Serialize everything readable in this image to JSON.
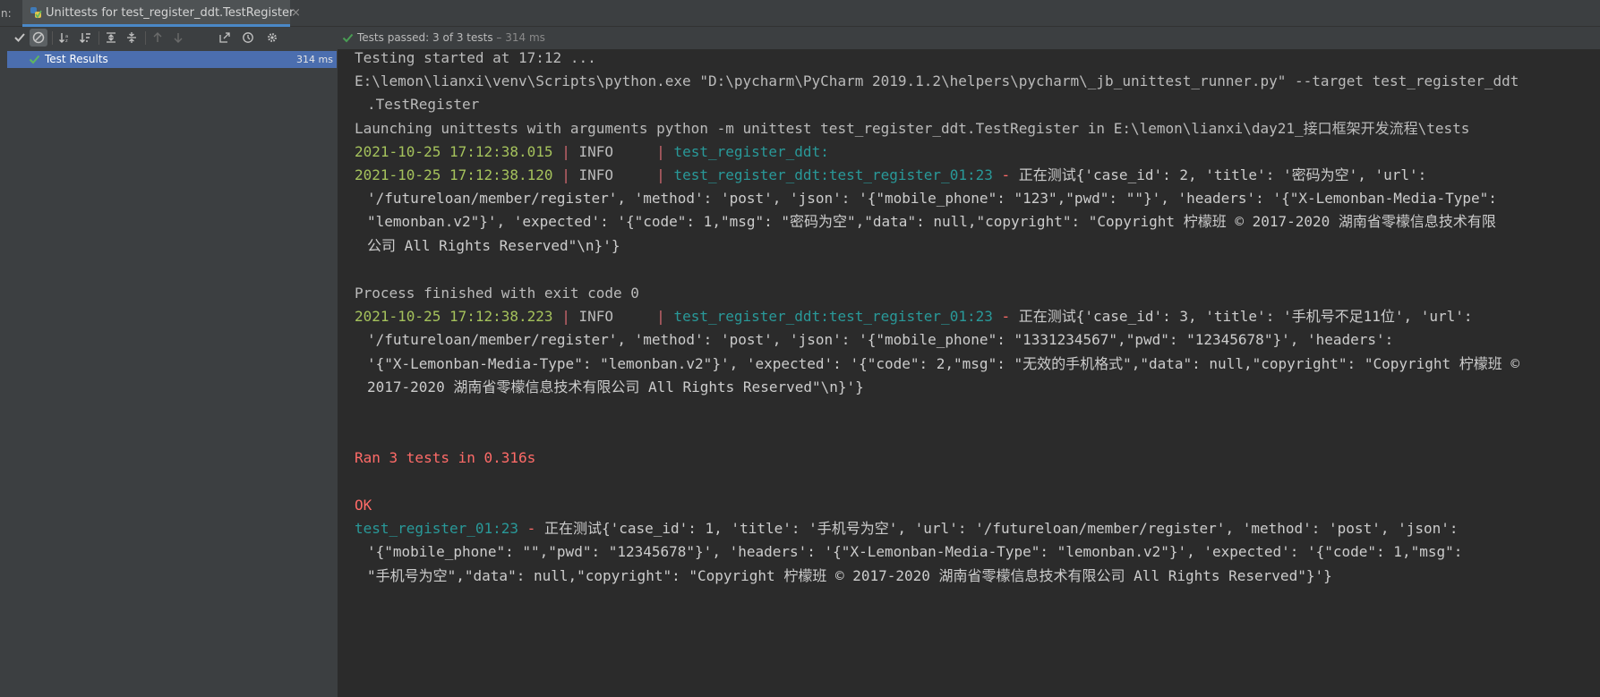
{
  "tabbar": {
    "prefix": "n:",
    "tab_label": "Unittests for test_register_ddt.TestRegister",
    "close_glyph": "×"
  },
  "toolbar": {
    "buttons": [
      "check-icon",
      "stop-icon",
      "sort-alpha-icon",
      "sort-duration-icon",
      "expand-all-icon",
      "collapse-all-icon",
      "prev-failed-icon",
      "next-failed-icon",
      "export-icon",
      "history-icon",
      "settings-icon"
    ]
  },
  "status": {
    "label": "Tests passed: ",
    "count": "3 of 3 tests",
    "duration": " – 314 ms"
  },
  "tree": {
    "items": [
      {
        "label": "Test Results",
        "time": "314 ms"
      }
    ]
  },
  "console": {
    "l1": "Testing started at 17:12 ...",
    "l2": "E:\\lemon\\lianxi\\venv\\Scripts\\python.exe \"D:\\pycharm\\PyCharm 2019.1.2\\helpers\\pycharm\\_jb_unittest_runner.py\" --target test_register_ddt",
    "l3": ".TestRegister",
    "l4": "Launching unittests with arguments python -m unittest test_register_ddt.TestRegister in E:\\lemon\\lianxi\\day21_接口框架开发流程\\tests",
    "log1": {
      "ts": "2021-10-25 17:12:38.015",
      "sep": " | ",
      "level": "INFO     ",
      "sep2": "| ",
      "mod": "test_register_ddt:"
    },
    "log2": {
      "ts": "2021-10-25 17:12:38.120",
      "sep": " | ",
      "level": "INFO     ",
      "sep2": "| ",
      "mod": "test_register_ddt:test_register_01:",
      "lnum": "23",
      "dash": " - ",
      "msg": "正在测试{'case_id': 2, 'title': '密码为空', 'url':"
    },
    "log2_c1": "'/futureloan/member/register', 'method': 'post', 'json': '{\"mobile_phone\": \"123\",\"pwd\": \"\"}', 'headers': '{\"X-Lemonban-Media-Type\":",
    "log2_c2": "\"lemonban.v2\"}', 'expected': '{\"code\": 1,\"msg\": \"密码为空\",\"data\": null,\"copyright\": \"Copyright 柠檬班 © 2017-2020 湖南省零檬信息技术有限",
    "log2_c3": "公司 All Rights Reserved\"\\n}'}",
    "process": "Process finished with exit code 0",
    "log3": {
      "ts": "2021-10-25 17:12:38.223",
      "sep": " | ",
      "level": "INFO     ",
      "sep2": "| ",
      "mod": "test_register_ddt:test_register_01:",
      "lnum": "23",
      "dash": " - ",
      "msg": "正在测试{'case_id': 3, 'title': '手机号不足11位', 'url':"
    },
    "log3_c1": "'/futureloan/member/register', 'method': 'post', 'json': '{\"mobile_phone\": \"1331234567\",\"pwd\": \"12345678\"}', 'headers':",
    "log3_c2": "'{\"X-Lemonban-Media-Type\": \"lemonban.v2\"}', 'expected': '{\"code\": 2,\"msg\": \"无效的手机格式\",\"data\": null,\"copyright\": \"Copyright 柠檬班 ©",
    "log3_c3": "2017-2020 湖南省零檬信息技术有限公司 All Rights Reserved\"\\n}'}",
    "ran": "Ran 3 tests in 0.316s",
    "ok": "OK",
    "log4": {
      "mod": "test_register_01:",
      "lnum": "23",
      "dash": " - ",
      "msg": "正在测试{'case_id': 1, 'title': '手机号为空', 'url': '/futureloan/member/register', 'method': 'post', 'json':"
    },
    "log4_c1": "'{\"mobile_phone\": \"\",\"pwd\": \"12345678\"}', 'headers': '{\"X-Lemonban-Media-Type\": \"lemonban.v2\"}', 'expected': '{\"code\": 1,\"msg\":",
    "log4_c2": "\"手机号为空\",\"data\": null,\"copyright\": \"Copyright 柠檬班 © 2017-2020 湖南省零檬信息技术有限公司 All Rights Reserved\"}'}"
  },
  "colors": {
    "background": "#2b2b2b",
    "panel": "#3c3f41",
    "selection": "#4b6eaf",
    "timestamp": "#a5c25c",
    "module": "#299999",
    "error_red": "#ff6b68",
    "pass_green": "#499c54"
  }
}
